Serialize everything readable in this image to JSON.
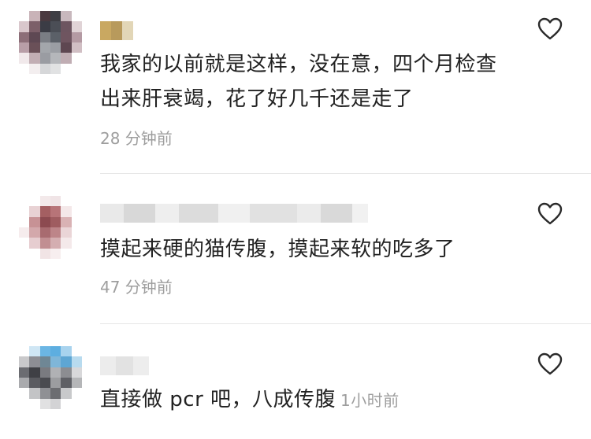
{
  "comments": [
    {
      "text": "我家的以前就是这样，没在意，四个月检查出来肝衰竭，花了好几千还是走了",
      "time": "28 分钟前"
    },
    {
      "text": "摸起来硬的猫传腹，摸起来软的吃多了",
      "time": "47 分钟前"
    },
    {
      "text": "直接做 pcr 吧，八成传腹",
      "time": "1小时前"
    }
  ],
  "icons": {
    "like": "heart-outline-icon"
  },
  "colors": {
    "text": "#222222",
    "meta": "#9e9e9e",
    "divider": "#e6e6e6"
  }
}
